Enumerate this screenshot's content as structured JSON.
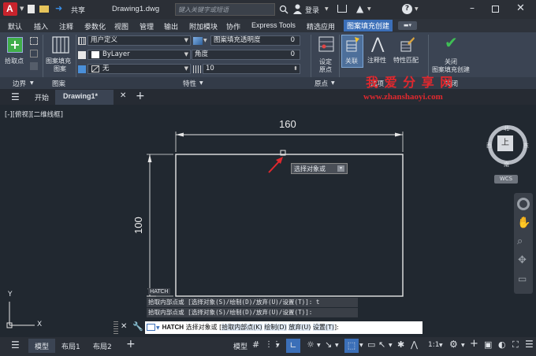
{
  "titlebar": {
    "app_logo": "A",
    "share_label": "共享",
    "document_title": "Drawing1.dwg",
    "search_placeholder": "键入关键字或短语",
    "login_label": "登录"
  },
  "menubar": {
    "items": [
      "默认",
      "插入",
      "注释",
      "参数化",
      "视图",
      "管理",
      "输出",
      "附加模块",
      "协作",
      "Express Tools",
      "精选应用",
      "图案填充创建"
    ],
    "active": "图案填充创建"
  },
  "ribbon": {
    "pick_point_label": "拾取点",
    "pattern_label_line1": "图案填充",
    "pattern_label_line2": "图案",
    "type_value": "用户定义",
    "color_value": "ByLayer",
    "bg_value": "无",
    "transparency_label": "图案填充透明度",
    "transparency_value": "0",
    "angle_label": "角度",
    "angle_value": "0",
    "spacing_value": "10",
    "set_origin_line1": "设定",
    "set_origin_line2": "原点",
    "associative_label": "关联",
    "annotative_label": "注释性",
    "match_props_label": "特性匹配",
    "close_line1": "关闭",
    "close_line2": "图案填充创建",
    "panel_boundary": "边界",
    "panel_pattern": "图案",
    "panel_properties": "特性",
    "panel_origin": "原点",
    "panel_options": "选项",
    "panel_close": "关闭"
  },
  "watermark": {
    "title": "我 爱 分 享 网",
    "url": "www.zhanshaoyi.com"
  },
  "tabs": {
    "start": "开始",
    "drawing": "Drawing1*",
    "add": "+"
  },
  "viewport": {
    "label": "[-][俯视][二维线框]",
    "dim_top": "160",
    "dim_left": "100",
    "hatch_label": "HATCH",
    "tooltip": "选择对象或",
    "viewcube_top": "上",
    "viewcube_n": "北",
    "viewcube_s": "南",
    "viewcube_e": "东",
    "viewcube_w": "西",
    "wcs": "WCS",
    "ucs_y": "Y",
    "ucs_x": "X"
  },
  "command": {
    "history1": "拾取内部点或 [选择对象(S)/绘制(D)/放弃(U)/设置(T)]: t",
    "history2": "拾取内部点或 [选择对象(S)/绘制(D)/放弃(U)/设置(T)]:",
    "prompt_cmd": "HATCH",
    "prompt_text": "选择对象或",
    "opt1": "拾取内部点(K)",
    "opt2": "绘制(D)",
    "opt3": "放弃(U)",
    "opt4": "设置(T)",
    "suffix": "]:"
  },
  "statusbar": {
    "model_tab": "模型",
    "layout1": "布局1",
    "layout2": "布局2",
    "model_label": "模型",
    "scale": "1:1"
  },
  "colors": {
    "accent": "#3b6fb8",
    "watermark_red": "#e0282e",
    "drawing_white": "#e6e6e6"
  }
}
